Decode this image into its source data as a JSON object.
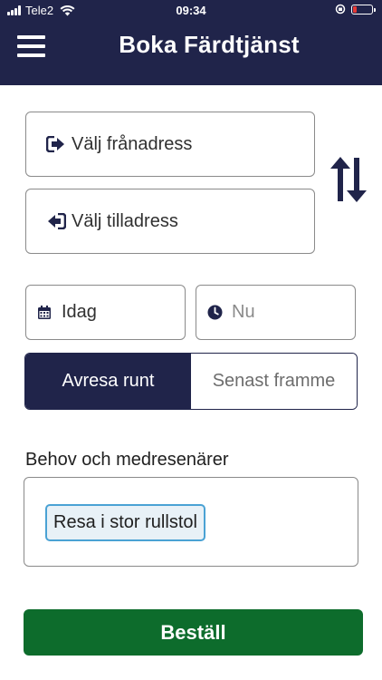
{
  "status_bar": {
    "carrier": "Tele2",
    "time": "09:34",
    "battery_level": 0.18,
    "battery_color": "#e53935"
  },
  "header": {
    "title": "Boka Färdtjänst",
    "background_color": "#20244a",
    "menu_icon": "hamburger-menu-icon"
  },
  "addresses": {
    "from_placeholder": "Välj frånadress",
    "from_icon": "sign-in-arrow-icon",
    "to_placeholder": "Välj tilladress",
    "to_icon": "sign-out-arrow-icon",
    "swap_icon": "swap-vertical-arrows-icon"
  },
  "datetime": {
    "date_value": "Idag",
    "date_icon": "calendar-icon",
    "time_value": "Nu",
    "time_icon": "clock-icon"
  },
  "trip_mode": {
    "options": [
      "Avresa runt",
      "Senast framme"
    ],
    "selected": "Avresa runt",
    "active_color": "#20244a"
  },
  "needs": {
    "label": "Behov och medresenärer",
    "chips": [
      "Resa i stor rullstol"
    ],
    "chip_border_color": "#4aa2d4"
  },
  "order_button": {
    "label": "Beställ",
    "color": "#0d6c2c"
  }
}
